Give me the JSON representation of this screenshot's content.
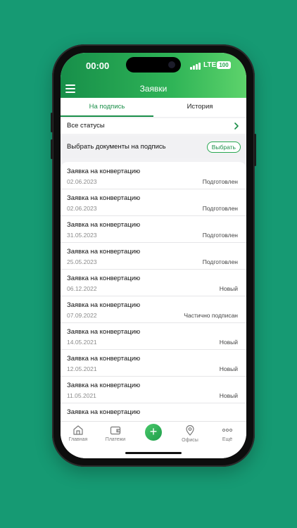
{
  "status_bar": {
    "time": "00:00",
    "network": "LTE",
    "battery": "100"
  },
  "app_bar": {
    "title": "Заявки"
  },
  "tabs": [
    {
      "label": "На подпись",
      "active": true
    },
    {
      "label": "История",
      "active": false
    }
  ],
  "filter": {
    "label": "Все статусы"
  },
  "select_docs": {
    "label": "Выбрать документы на подпись",
    "button": "Выбрать"
  },
  "requests": [
    {
      "title": "Заявка на конвертацию",
      "date": "02.06.2023",
      "status": "Подготовлен"
    },
    {
      "title": "Заявка на конвертацию",
      "date": "02.06.2023",
      "status": "Подготовлен"
    },
    {
      "title": "Заявка на конвертацию",
      "date": "31.05.2023",
      "status": "Подготовлен"
    },
    {
      "title": "Заявка на конвертацию",
      "date": "25.05.2023",
      "status": "Подготовлен"
    },
    {
      "title": "Заявка на конвертацию",
      "date": "06.12.2022",
      "status": "Новый"
    },
    {
      "title": "Заявка на конвертацию",
      "date": "07.09.2022",
      "status": "Частично подписан"
    },
    {
      "title": "Заявка на конвертацию",
      "date": "14.05.2021",
      "status": "Новый"
    },
    {
      "title": "Заявка на конвертацию",
      "date": "12.05.2021",
      "status": "Новый"
    },
    {
      "title": "Заявка на конвертацию",
      "date": "11.05.2021",
      "status": "Новый"
    },
    {
      "title": "Заявка на конвертацию",
      "date": "",
      "status": ""
    }
  ],
  "bottom_nav": [
    {
      "label": "Главная",
      "icon": "home-icon"
    },
    {
      "label": "Платежи",
      "icon": "wallet-icon"
    },
    {
      "label": "+",
      "icon": "plus-icon"
    },
    {
      "label": "Офисы",
      "icon": "location-pin-icon"
    },
    {
      "label": "Ещё",
      "icon": "more-dots-icon"
    }
  ],
  "colors": {
    "accent": "#1b8f49",
    "background": "#169a73",
    "gradient_end": "#5dd36b"
  }
}
